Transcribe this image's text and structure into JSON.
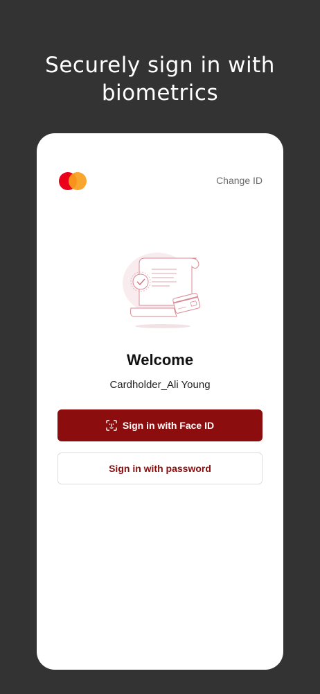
{
  "promo": {
    "headline": "Securely sign in with biometrics"
  },
  "card": {
    "change_id_label": "Change ID",
    "welcome_title": "Welcome",
    "username": "Cardholder_Ali Young",
    "face_id_button_label": "Sign in with Face ID",
    "password_button_label": "Sign in with password"
  },
  "colors": {
    "background": "#333333",
    "card": "#ffffff",
    "accent": "#8b0d0d",
    "mastercard_red": "#eb001b",
    "mastercard_orange": "#f79e1b"
  },
  "icons": {
    "logo": "mastercard-logo",
    "face_id": "face-id-icon",
    "illustration": "receipt-card-illustration"
  }
}
